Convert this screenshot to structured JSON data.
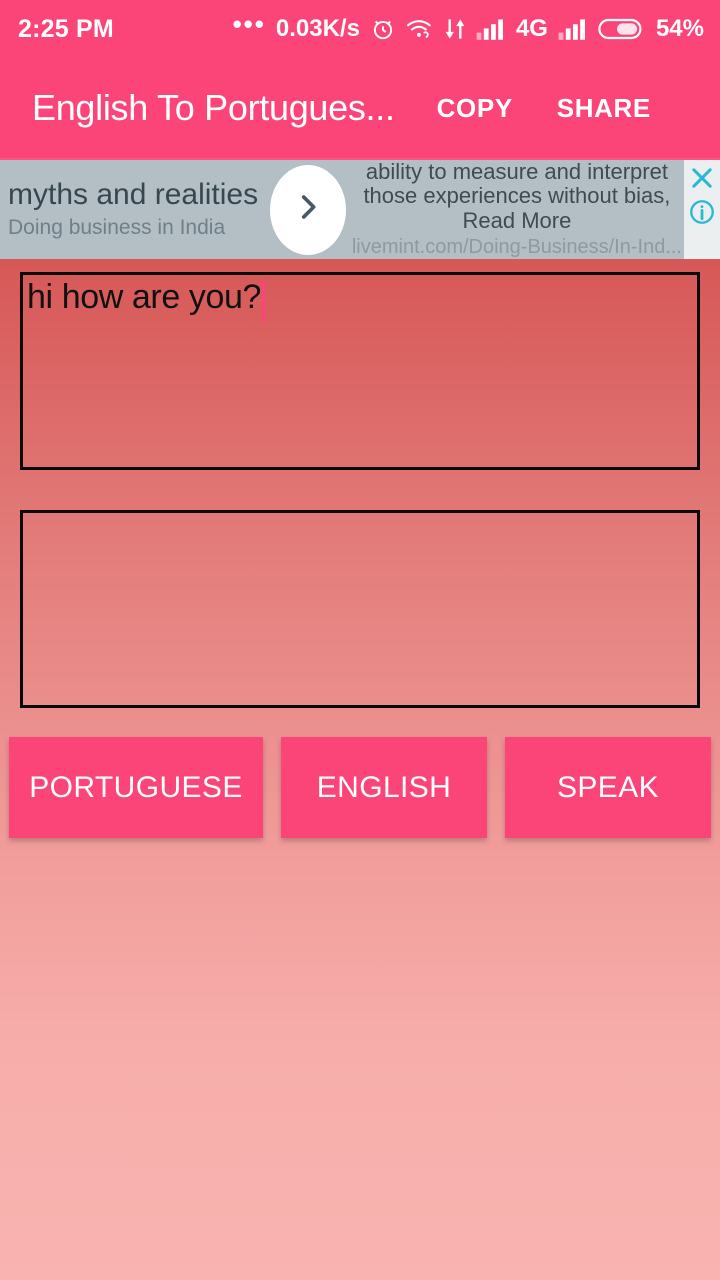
{
  "status_bar": {
    "clock": "2:25 PM",
    "overflow_dots": "•••",
    "network_speed": "0.03K/s",
    "icons": [
      "alarm-clock-icon",
      "wifi-icon",
      "data-transfer-icon",
      "signal-bars-icon",
      "signal-bars-icon-2"
    ],
    "network_type": "4G",
    "battery_percent": "54%"
  },
  "app_bar": {
    "title": "English To Portugues...",
    "copy_label": "COPY",
    "share_label": "SHARE",
    "background_color": "#FB4478"
  },
  "ad_banner": {
    "headline": "myths and realities",
    "subline": "Doing business in India",
    "cta_icon": "chevron-right-icon",
    "body": "ability to measure and interpret\nthose experiences without bias,\nRead More",
    "url": "livemint.com/Doing-Business/In-Ind...",
    "close_icon": "close-icon",
    "info_icon": "info-icon",
    "background_color": "#B3BFC5",
    "icon_color": "#2BB8D4"
  },
  "input_area": {
    "name": "source-text-input",
    "value": "hi how are you?",
    "placeholder": "",
    "caret_color": "#FF4081"
  },
  "output_area": {
    "name": "translated-text-output",
    "value": "",
    "placeholder": ""
  },
  "actions": {
    "translate_label": "PORTUGUESE",
    "reverse_label": "ENGLISH",
    "speak_label": "SPEAK",
    "button_color": "#FB4478"
  },
  "theme": {
    "gradient_top": "#C9403C",
    "gradient_bottom": "#F9B3B0",
    "accent": "#FB4478"
  }
}
